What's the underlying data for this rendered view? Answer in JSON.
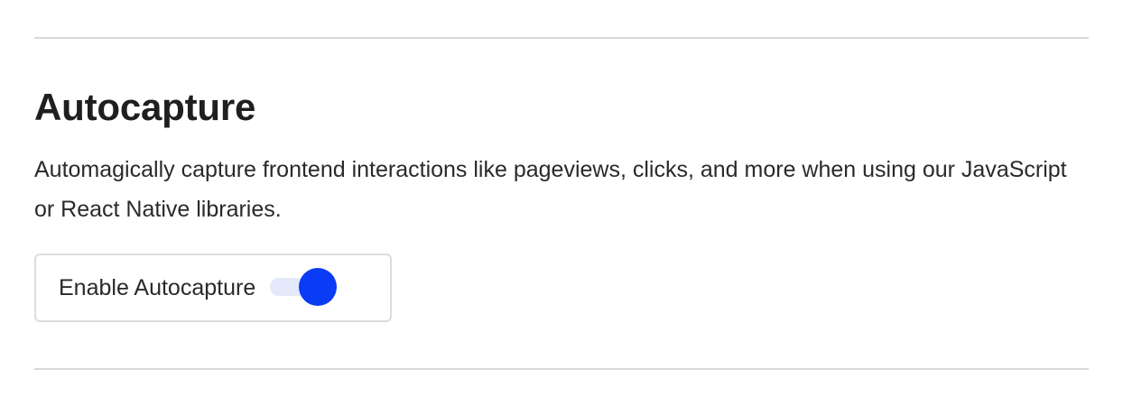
{
  "section": {
    "title": "Autocapture",
    "description": "Automagically capture frontend interactions like pageviews, clicks, and more when using our JavaScript or React Native libraries."
  },
  "toggle": {
    "label": "Enable Autocapture",
    "enabled": true
  },
  "colors": {
    "accent": "#0a3cf5",
    "track_on": "#e3e8fb",
    "divider": "#d9d9d9",
    "text": "#1f1f1f"
  }
}
